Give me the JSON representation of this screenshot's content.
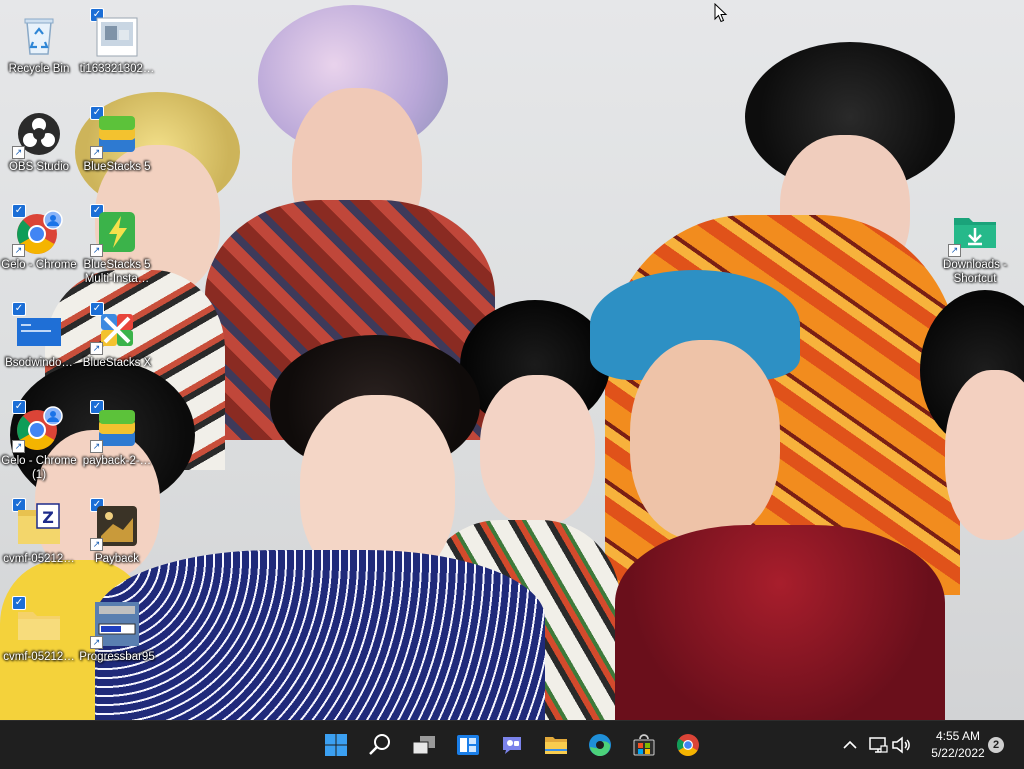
{
  "desktop": {
    "wallpaper_subject": "group photo",
    "icons": [
      {
        "label": "Recycle Bin"
      },
      {
        "label": "ti163321302…"
      },
      {
        "label": "OBS Studio"
      },
      {
        "label": "BlueStacks 5"
      },
      {
        "label": "Gelo - Chrome"
      },
      {
        "label": "BlueStacks 5 Multi-Insta…"
      },
      {
        "label": "Bsodwindo…"
      },
      {
        "label": "BlueStacks X"
      },
      {
        "label": "Gelo - Chrome (1)"
      },
      {
        "label": "payback-2-…"
      },
      {
        "label": "cvmf-05212…"
      },
      {
        "label": "Payback"
      },
      {
        "label": "cvmf-05212…"
      },
      {
        "label": "Progressbar95"
      },
      {
        "label": "Downloads - Shortcut"
      }
    ]
  },
  "taskbar": {
    "apps": [
      {
        "icon": "start-icon"
      },
      {
        "icon": "search-icon"
      },
      {
        "icon": "task-view-icon"
      },
      {
        "icon": "widgets-icon"
      },
      {
        "icon": "chat-icon"
      },
      {
        "icon": "file-explorer-icon"
      },
      {
        "icon": "edge-icon"
      },
      {
        "icon": "store-icon"
      },
      {
        "icon": "chrome-icon"
      }
    ],
    "tray": {
      "time": "4:55 AM",
      "date": "5/22/2022",
      "notification_count": "2"
    }
  },
  "colors": {
    "taskbar": "#1f1f1f",
    "accent": "#0078d4"
  }
}
